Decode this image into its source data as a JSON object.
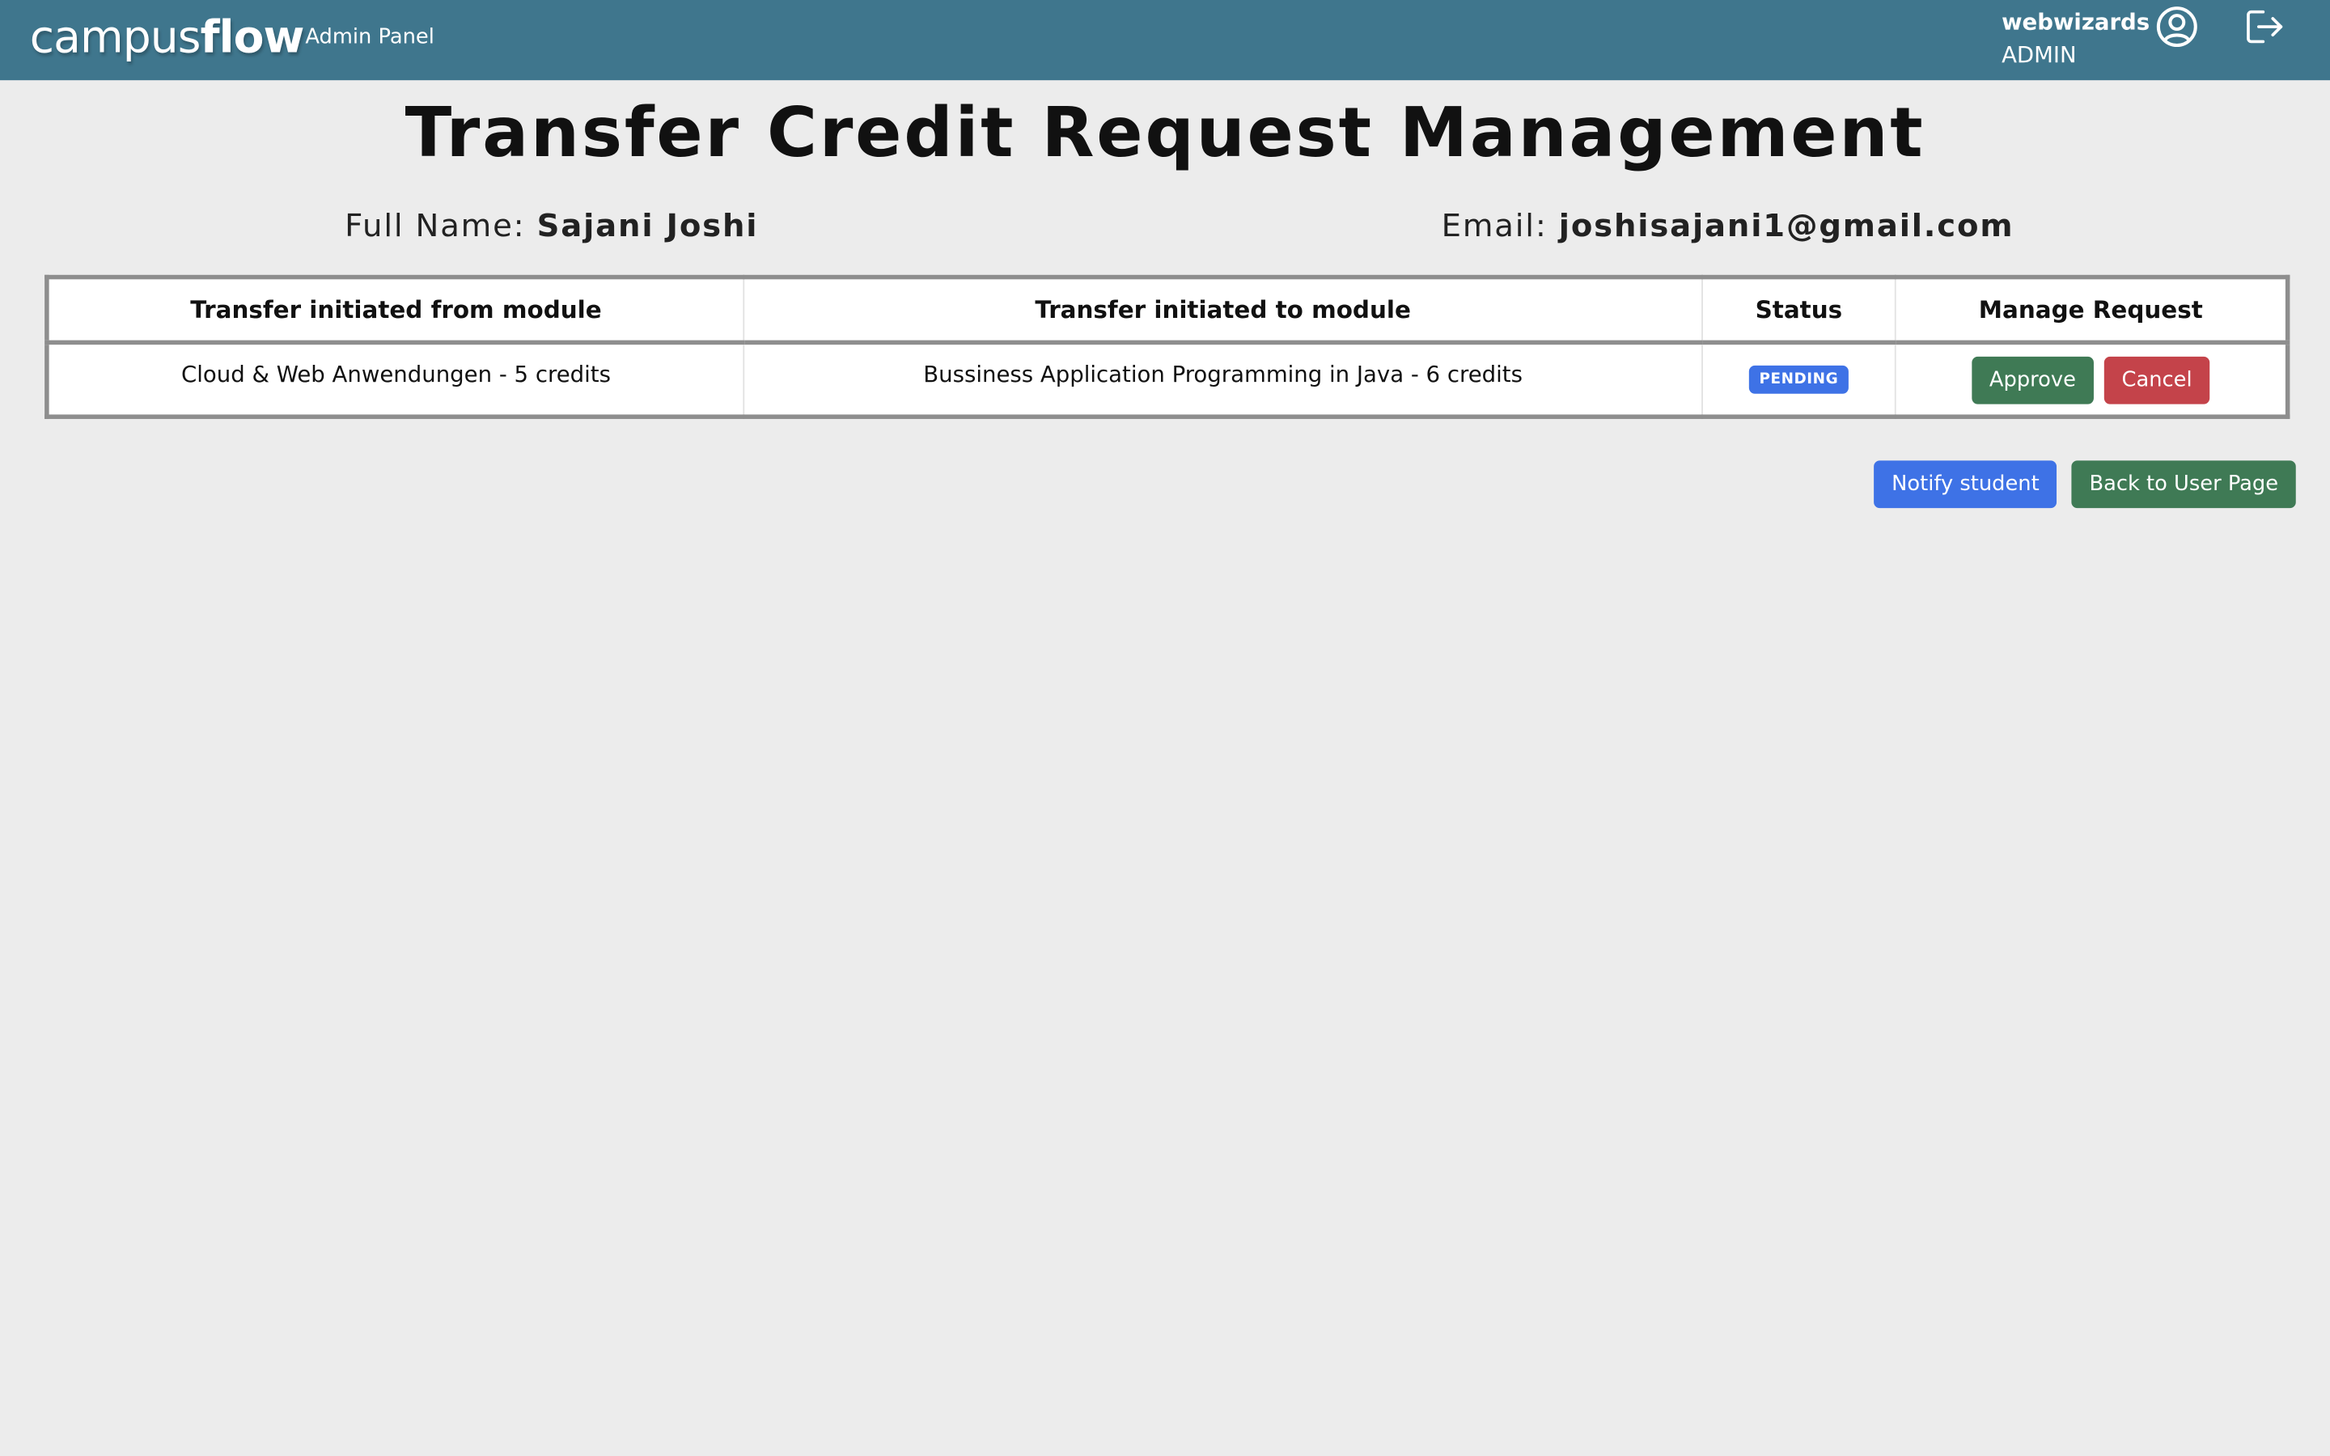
{
  "header": {
    "brand_light": "campus",
    "brand_bold": "flow",
    "brand_sub": "Admin Panel",
    "username": "webwizards",
    "role": "ADMIN",
    "account_icon": "account-circle-icon",
    "logout_icon": "logout-icon",
    "bar_color": "#3f768d"
  },
  "page": {
    "title": "Transfer Credit Request Management",
    "name_label": "Full Name:",
    "name_value": "Sajani Joshi",
    "email_label": "Email:",
    "email_value": "joshisajani1@gmail.com"
  },
  "table": {
    "headers": [
      "Transfer initiated from module",
      "Transfer initiated to module",
      "Status",
      "Manage Request"
    ],
    "rows": [
      {
        "from": "Cloud & Web Anwendungen - 5 credits",
        "to": "Bussiness Application Programming in Java - 6 credits",
        "status": "PENDING",
        "approve_label": "Approve",
        "cancel_label": "Cancel"
      }
    ]
  },
  "actions": {
    "notify_label": "Notify student",
    "back_label": "Back to User Page"
  },
  "colors": {
    "primary_blue": "#3e72e6",
    "success_green": "#3f7a55",
    "danger_red": "#c4434a"
  }
}
